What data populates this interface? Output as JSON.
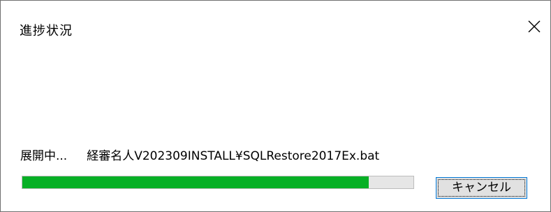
{
  "window": {
    "title": "進捗状況",
    "close_icon": "close-icon"
  },
  "status": {
    "label": "展開中...",
    "file_path": "経審名人V202309INSTALL¥SQLRestore2017Ex.bat"
  },
  "progress": {
    "fraction": 0.885,
    "fill_color": "#06b025",
    "track_color": "#e6e6e6"
  },
  "buttons": {
    "cancel_label": "キャンセル"
  },
  "colors": {
    "focus_border": "#0078d7"
  }
}
